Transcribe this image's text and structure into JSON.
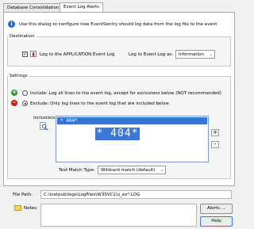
{
  "tabs": [
    {
      "label": "Database Consolidation",
      "active": false
    },
    {
      "label": "Event Log Alerts",
      "active": true
    }
  ],
  "info_text": "Use this dialog to configure how EventSentry should log data from the log file to the event",
  "destination": {
    "title": "Destination",
    "log_to_app_checked": true,
    "log_to_app_label": "Log to the APPLICATION Event Log",
    "log_as_label": "Log to Event Log as:",
    "log_as_value": "Information"
  },
  "settings": {
    "title": "Settings",
    "include_label": "Include: Log all lines to the event log, except for exclusions below (NOT recommended)",
    "exclude_label": "Exclude: Only log lines to the event log that are included below",
    "inclusions_label": "Inclusions:",
    "inclusion_items": [
      "* 404*"
    ],
    "zoom_text": "* 404*",
    "add_label": "+",
    "remove_label": "-",
    "text_match_label": "Text Match Type:",
    "text_match_value": "Wildcard match (default)"
  },
  "file_path_label": "File Path:",
  "file_path_value": "C:\\inetpub\\logs\\LogFiles\\W3SVC1\\u_ex*.LOG",
  "notes_label": "Notes:",
  "notes_value": "",
  "alerts_button": "Alerts ...",
  "help_button": "Help",
  "colors": {
    "accent": "#3875d7",
    "info": "#1e6fd0",
    "include_icon": "#2e9e2e",
    "exclude_icon": "#c82020"
  }
}
